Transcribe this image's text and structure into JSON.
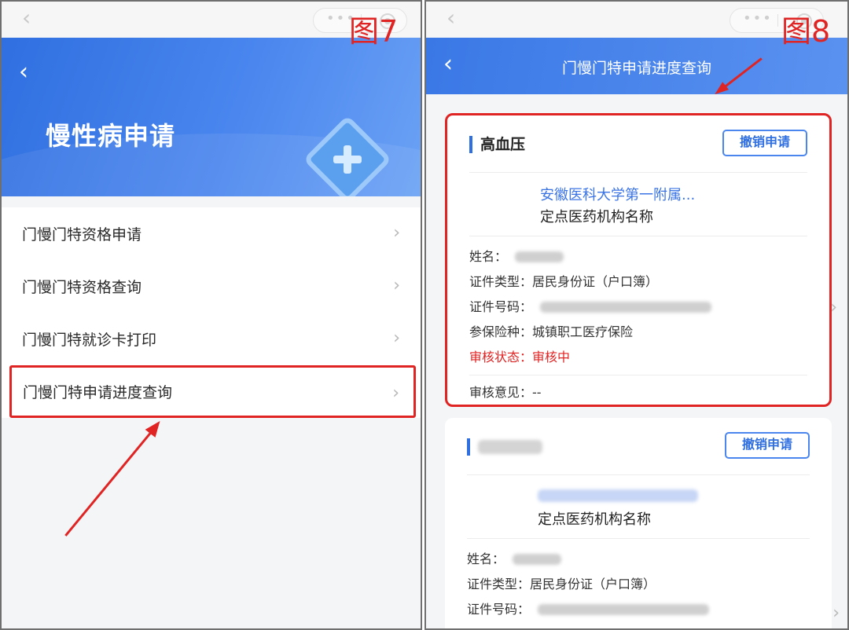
{
  "figure_left": {
    "label": "图7"
  },
  "figure_right": {
    "label": "图8"
  },
  "left": {
    "back_icon": "chevron-left-icon",
    "title": "慢性病申请",
    "hero_icon": "medical-plus-icon",
    "menu": [
      {
        "label": "门慢门特资格申请",
        "highlighted": false
      },
      {
        "label": "门慢门特资格查询",
        "highlighted": false
      },
      {
        "label": "门慢门特就诊卡打印",
        "highlighted": false
      },
      {
        "label": "门慢门特申请进度查询",
        "highlighted": true
      }
    ]
  },
  "right": {
    "back_icon": "chevron-left-icon",
    "title": "门慢门特申请进度查询",
    "cards": [
      {
        "disease": "高血压",
        "revoke_label": "撤销申请",
        "institution": "安徽医科大学第一附属...",
        "institution_label": "定点医药机构名称",
        "name_label": "姓名：",
        "id_type_label": "证件类型：",
        "id_type_value": "居民身份证（户口簿）",
        "id_no_label": "证件号码：",
        "insurance_label": "参保险种：",
        "insurance_value": "城镇职工医疗保险",
        "status_label": "审核状态：",
        "status_value": "审核中",
        "opinion_label": "审核意见：",
        "opinion_value": "--",
        "status_color": "#e02424"
      },
      {
        "revoke_label": "撤销申请",
        "institution_label": "定点医药机构名称",
        "name_label": "姓名：",
        "id_type_label": "证件类型：",
        "id_type_value": "居民身份证（户口簿）",
        "id_no_label": "证件号码："
      }
    ]
  },
  "colors": {
    "brand_blue": "#2f6fe0",
    "annotation_red": "#e02424"
  }
}
